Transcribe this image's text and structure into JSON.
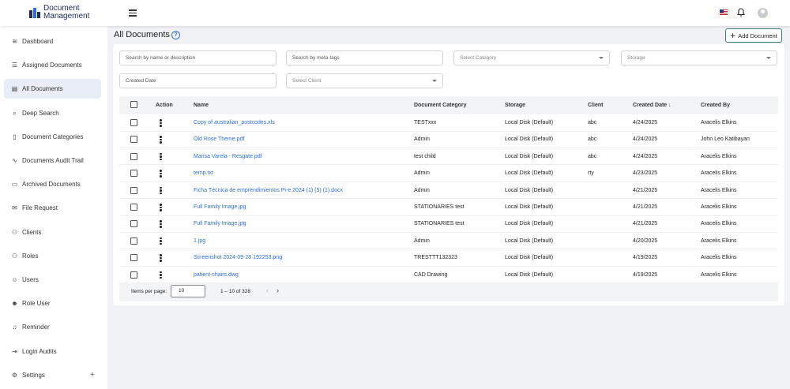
{
  "app": {
    "logo_line1": "Document",
    "logo_line2": "Management"
  },
  "sidebar": {
    "items": [
      {
        "label": "Dashboard",
        "icon": "layers-icon"
      },
      {
        "label": "Assigned Documents",
        "icon": "list-icon"
      },
      {
        "label": "All Documents",
        "icon": "document-icon",
        "active": true
      },
      {
        "label": "Deep Search",
        "icon": "search-icon"
      },
      {
        "label": "Document Categories",
        "icon": "file-icon"
      },
      {
        "label": "Documents Audit Trail",
        "icon": "activity-icon"
      },
      {
        "label": "Archived Documents",
        "icon": "archive-icon"
      },
      {
        "label": "File Request",
        "icon": "mail-icon"
      },
      {
        "label": "Clients",
        "icon": "users-icon"
      },
      {
        "label": "Roles",
        "icon": "users-icon"
      },
      {
        "label": "Users",
        "icon": "user-icon"
      },
      {
        "label": "Role User",
        "icon": "user-check-icon"
      },
      {
        "label": "Reminder",
        "icon": "bell-icon"
      },
      {
        "label": "Login Audits",
        "icon": "login-icon"
      },
      {
        "label": "Settings",
        "icon": "gear-icon"
      }
    ],
    "settings_plus": "+"
  },
  "page": {
    "title": "All Documents",
    "help": "?",
    "add_button": "Add Document",
    "add_plus": "+"
  },
  "filters": {
    "search_name": "Search by name or description",
    "search_meta": "Search by meta tags",
    "category": "Select Category",
    "storage": "Storage",
    "created_date": "Created Date",
    "client": "Select Client"
  },
  "table": {
    "headers": {
      "action": "Action",
      "name": "Name",
      "category": "Document Category",
      "storage": "Storage",
      "client": "Client",
      "created_date": "Created Date",
      "sort_arrow": "↓",
      "created_by": "Created By"
    },
    "rows": [
      {
        "name": "Copy of australian_postcodes.xls",
        "category": "TESTxxx",
        "storage": "Local Disk (Default)",
        "client": "abc",
        "date": "4/24/2025",
        "by": "Aracelis Elkins"
      },
      {
        "name": "Old Rose Theme.pdf",
        "category": "Admin",
        "storage": "Local Disk (Default)",
        "client": "abc",
        "date": "4/24/2025",
        "by": "John Leo Katibayan"
      },
      {
        "name": "Marisa Varela - Resgate.pdf",
        "category": "test child",
        "storage": "Local Disk (Default)",
        "client": "abc",
        "date": "4/24/2025",
        "by": "Aracelis Elkins"
      },
      {
        "name": "temp.txt",
        "category": "Admin",
        "storage": "Local Disk (Default)",
        "client": "rty",
        "date": "4/23/2025",
        "by": "Aracelis Elkins"
      },
      {
        "name": "Ficha Técnica de emprendimientos Pi-e 2024 (1) (5) (1).docx",
        "category": "Admin",
        "storage": "Local Disk (Default)",
        "client": "",
        "date": "4/21/2025",
        "by": "Aracelis Elkins"
      },
      {
        "name": "Full Family Image.jpg",
        "category": "STATIONARIES test",
        "storage": "Local Disk (Default)",
        "client": "",
        "date": "4/21/2025",
        "by": "Aracelis Elkins"
      },
      {
        "name": "Full Family Image.jpg",
        "category": "STATIONARIES test",
        "storage": "Local Disk (Default)",
        "client": "",
        "date": "4/21/2025",
        "by": "Aracelis Elkins"
      },
      {
        "name": "1.jpg",
        "category": "Admin",
        "storage": "Local Disk (Default)",
        "client": "",
        "date": "4/20/2025",
        "by": "Aracelis Elkins"
      },
      {
        "name": "Screenshot 2024-09-28 192253.png",
        "category": "TRESTTT132323",
        "storage": "Local Disk (Default)",
        "client": "",
        "date": "4/19/2025",
        "by": "Aracelis Elkins"
      },
      {
        "name": "patient-chairs.dwg",
        "category": "CAD Drawing",
        "storage": "Local Disk (Default)",
        "client": "",
        "date": "4/19/2025",
        "by": "Aracelis Elkins"
      }
    ]
  },
  "pager": {
    "label": "Items per page:",
    "size": "10",
    "range": "1 – 10 of 328",
    "prev": "‹",
    "next": "›"
  }
}
